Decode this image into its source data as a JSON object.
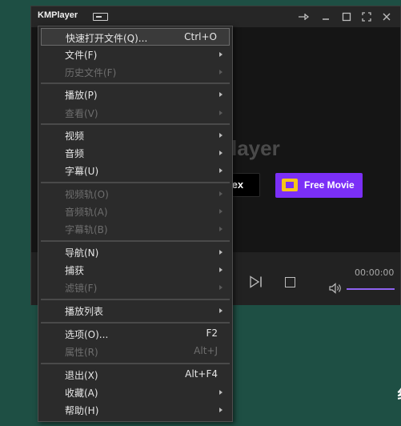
{
  "player": {
    "title": "KMPlayer",
    "brand_text": "layer",
    "plex_label": "lex",
    "freemovie_label": "Free Movie",
    "time": "00:00:00",
    "volume_fraction": 1.0,
    "accent_color": "#7b2ff7"
  },
  "desktop": {
    "glyph1": "=",
    "glyph2": "纟"
  },
  "menu": {
    "items": [
      {
        "label": "快速打开文件(Q)...",
        "shortcut": "Ctrl+O",
        "submenu": false,
        "disabled": false,
        "highlight": true
      },
      {
        "label": "文件(F)",
        "shortcut": "",
        "submenu": true,
        "disabled": false
      },
      {
        "label": "历史文件(F)",
        "shortcut": "",
        "submenu": true,
        "disabled": true
      },
      {
        "label": "播放(P)",
        "shortcut": "",
        "submenu": true,
        "disabled": false
      },
      {
        "label": "查看(V)",
        "shortcut": "",
        "submenu": true,
        "disabled": true
      },
      {
        "label": "视频",
        "shortcut": "",
        "submenu": true,
        "disabled": false
      },
      {
        "label": "音频",
        "shortcut": "",
        "submenu": true,
        "disabled": false
      },
      {
        "label": "字幕(U)",
        "shortcut": "",
        "submenu": true,
        "disabled": false
      },
      {
        "label": "视频轨(O)",
        "shortcut": "",
        "submenu": true,
        "disabled": true
      },
      {
        "label": "音频轨(A)",
        "shortcut": "",
        "submenu": true,
        "disabled": true
      },
      {
        "label": "字幕轨(B)",
        "shortcut": "",
        "submenu": true,
        "disabled": true
      },
      {
        "label": "导航(N)",
        "shortcut": "",
        "submenu": true,
        "disabled": false
      },
      {
        "label": "捕获",
        "shortcut": "",
        "submenu": true,
        "disabled": false
      },
      {
        "label": "滤镜(F)",
        "shortcut": "",
        "submenu": true,
        "disabled": true
      },
      {
        "label": "播放列表",
        "shortcut": "",
        "submenu": true,
        "disabled": false
      },
      {
        "label": "选项(O)...",
        "shortcut": "F2",
        "submenu": false,
        "disabled": false
      },
      {
        "label": "属性(R)",
        "shortcut": "Alt+J",
        "submenu": false,
        "disabled": true
      },
      {
        "label": "退出(X)",
        "shortcut": "Alt+F4",
        "submenu": false,
        "disabled": false
      },
      {
        "label": "收藏(A)",
        "shortcut": "",
        "submenu": true,
        "disabled": false
      },
      {
        "label": "帮助(H)",
        "shortcut": "",
        "submenu": true,
        "disabled": false
      }
    ]
  }
}
